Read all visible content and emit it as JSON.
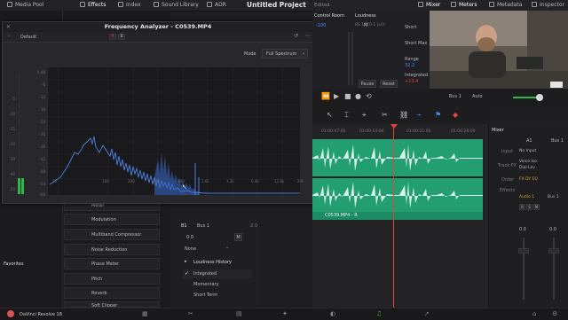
{
  "topbar": {
    "media_pool": "Media Pool",
    "effects": "Effects",
    "index": "Index",
    "sound_library": "Sound Library",
    "adr": "ADR",
    "project_title": "Untitled Project",
    "edited": "Edited",
    "mixer": "Mixer",
    "meters": "Meters",
    "metadata": "Metadata",
    "inspector": "Inspector"
  },
  "analyzer": {
    "title": "Frequency Analyzer - C0539.MP4",
    "preset": "Default",
    "btn_a": "A",
    "btn_b": "B",
    "mode_label": "Mode",
    "mode_value": "Full Spectrum",
    "y_ticks": [
      "0 dB",
      "-6",
      "-12",
      "-18",
      "-24",
      "-30",
      "-36",
      "-42",
      "-48",
      "-54",
      "-60"
    ],
    "x_ticks": [
      "20",
      "100",
      "200",
      "400",
      "800",
      "1.6k",
      "3.2k",
      "6.4k",
      "12.8k",
      "20k"
    ],
    "side_scale": [
      "-5",
      "-10",
      "-15",
      "-20",
      "-30",
      "-40",
      "-50"
    ],
    "side_bottom": "-20"
  },
  "control_room": {
    "title": "Control Room",
    "cr_value": "-100",
    "m_label": "M",
    "scale": [
      "0",
      "-5",
      "-10",
      "-15",
      "-20",
      "-30",
      "-40",
      "-50"
    ]
  },
  "loudness": {
    "title": "Loudness",
    "standard": "BS.1770-1 (LU)",
    "short": "Short",
    "short_max": "Short Max",
    "range": "Range",
    "range_value": "32.2",
    "integrated": "Integrated",
    "integrated_value": "+13.4",
    "pause": "Pause",
    "reset": "Reset"
  },
  "transport": {
    "bus": "Bus 1",
    "auto": "Auto"
  },
  "timeline": {
    "timecodes": [
      "01:00:07:00",
      "01:00:14:00",
      "01:00:21:00",
      "01:00:28:00"
    ],
    "clip_label": "C0539.MP4 - R"
  },
  "bus_panel": {
    "b1": "B1",
    "bus_name": "Bus 1",
    "value": "2.0",
    "gain": "0.0",
    "m": "M",
    "none": "None",
    "loudness_history": "Loudness History",
    "integrated": "Integrated",
    "momentary": "Momentary",
    "short_term": "Short Term"
  },
  "mixer": {
    "title": "Mixer",
    "a1": "A1",
    "bus1": "Bus 1",
    "input": "Input",
    "no_input": "No Input",
    "track_fx": "Track FX",
    "voice_iso": "Voice Iso",
    "dial_lev": "Dial Lev",
    "order": "Order",
    "order_value": "FX DY EQ",
    "effects": "Effects",
    "audio1": "Audio 1",
    "bus1_bottom": "Bus 1",
    "fader_val1": "0.0",
    "fader_val2": "0.0",
    "r_btn": "R",
    "s_btn": "S",
    "m_btn": "M"
  },
  "library": {
    "items": [
      "Meter",
      "Modulation",
      "Multiband Compressor",
      "Noise Reduction",
      "Phase Meter",
      "Pitch",
      "Reverb",
      "Soft Clipper"
    ],
    "favorites": "Favorites"
  },
  "app": {
    "name": "DaVinci Resolve 18"
  },
  "colors": {
    "accent_green": "#239e72",
    "spectrum_blue": "#4a7fe0",
    "playhead_red": "#e0443c"
  }
}
